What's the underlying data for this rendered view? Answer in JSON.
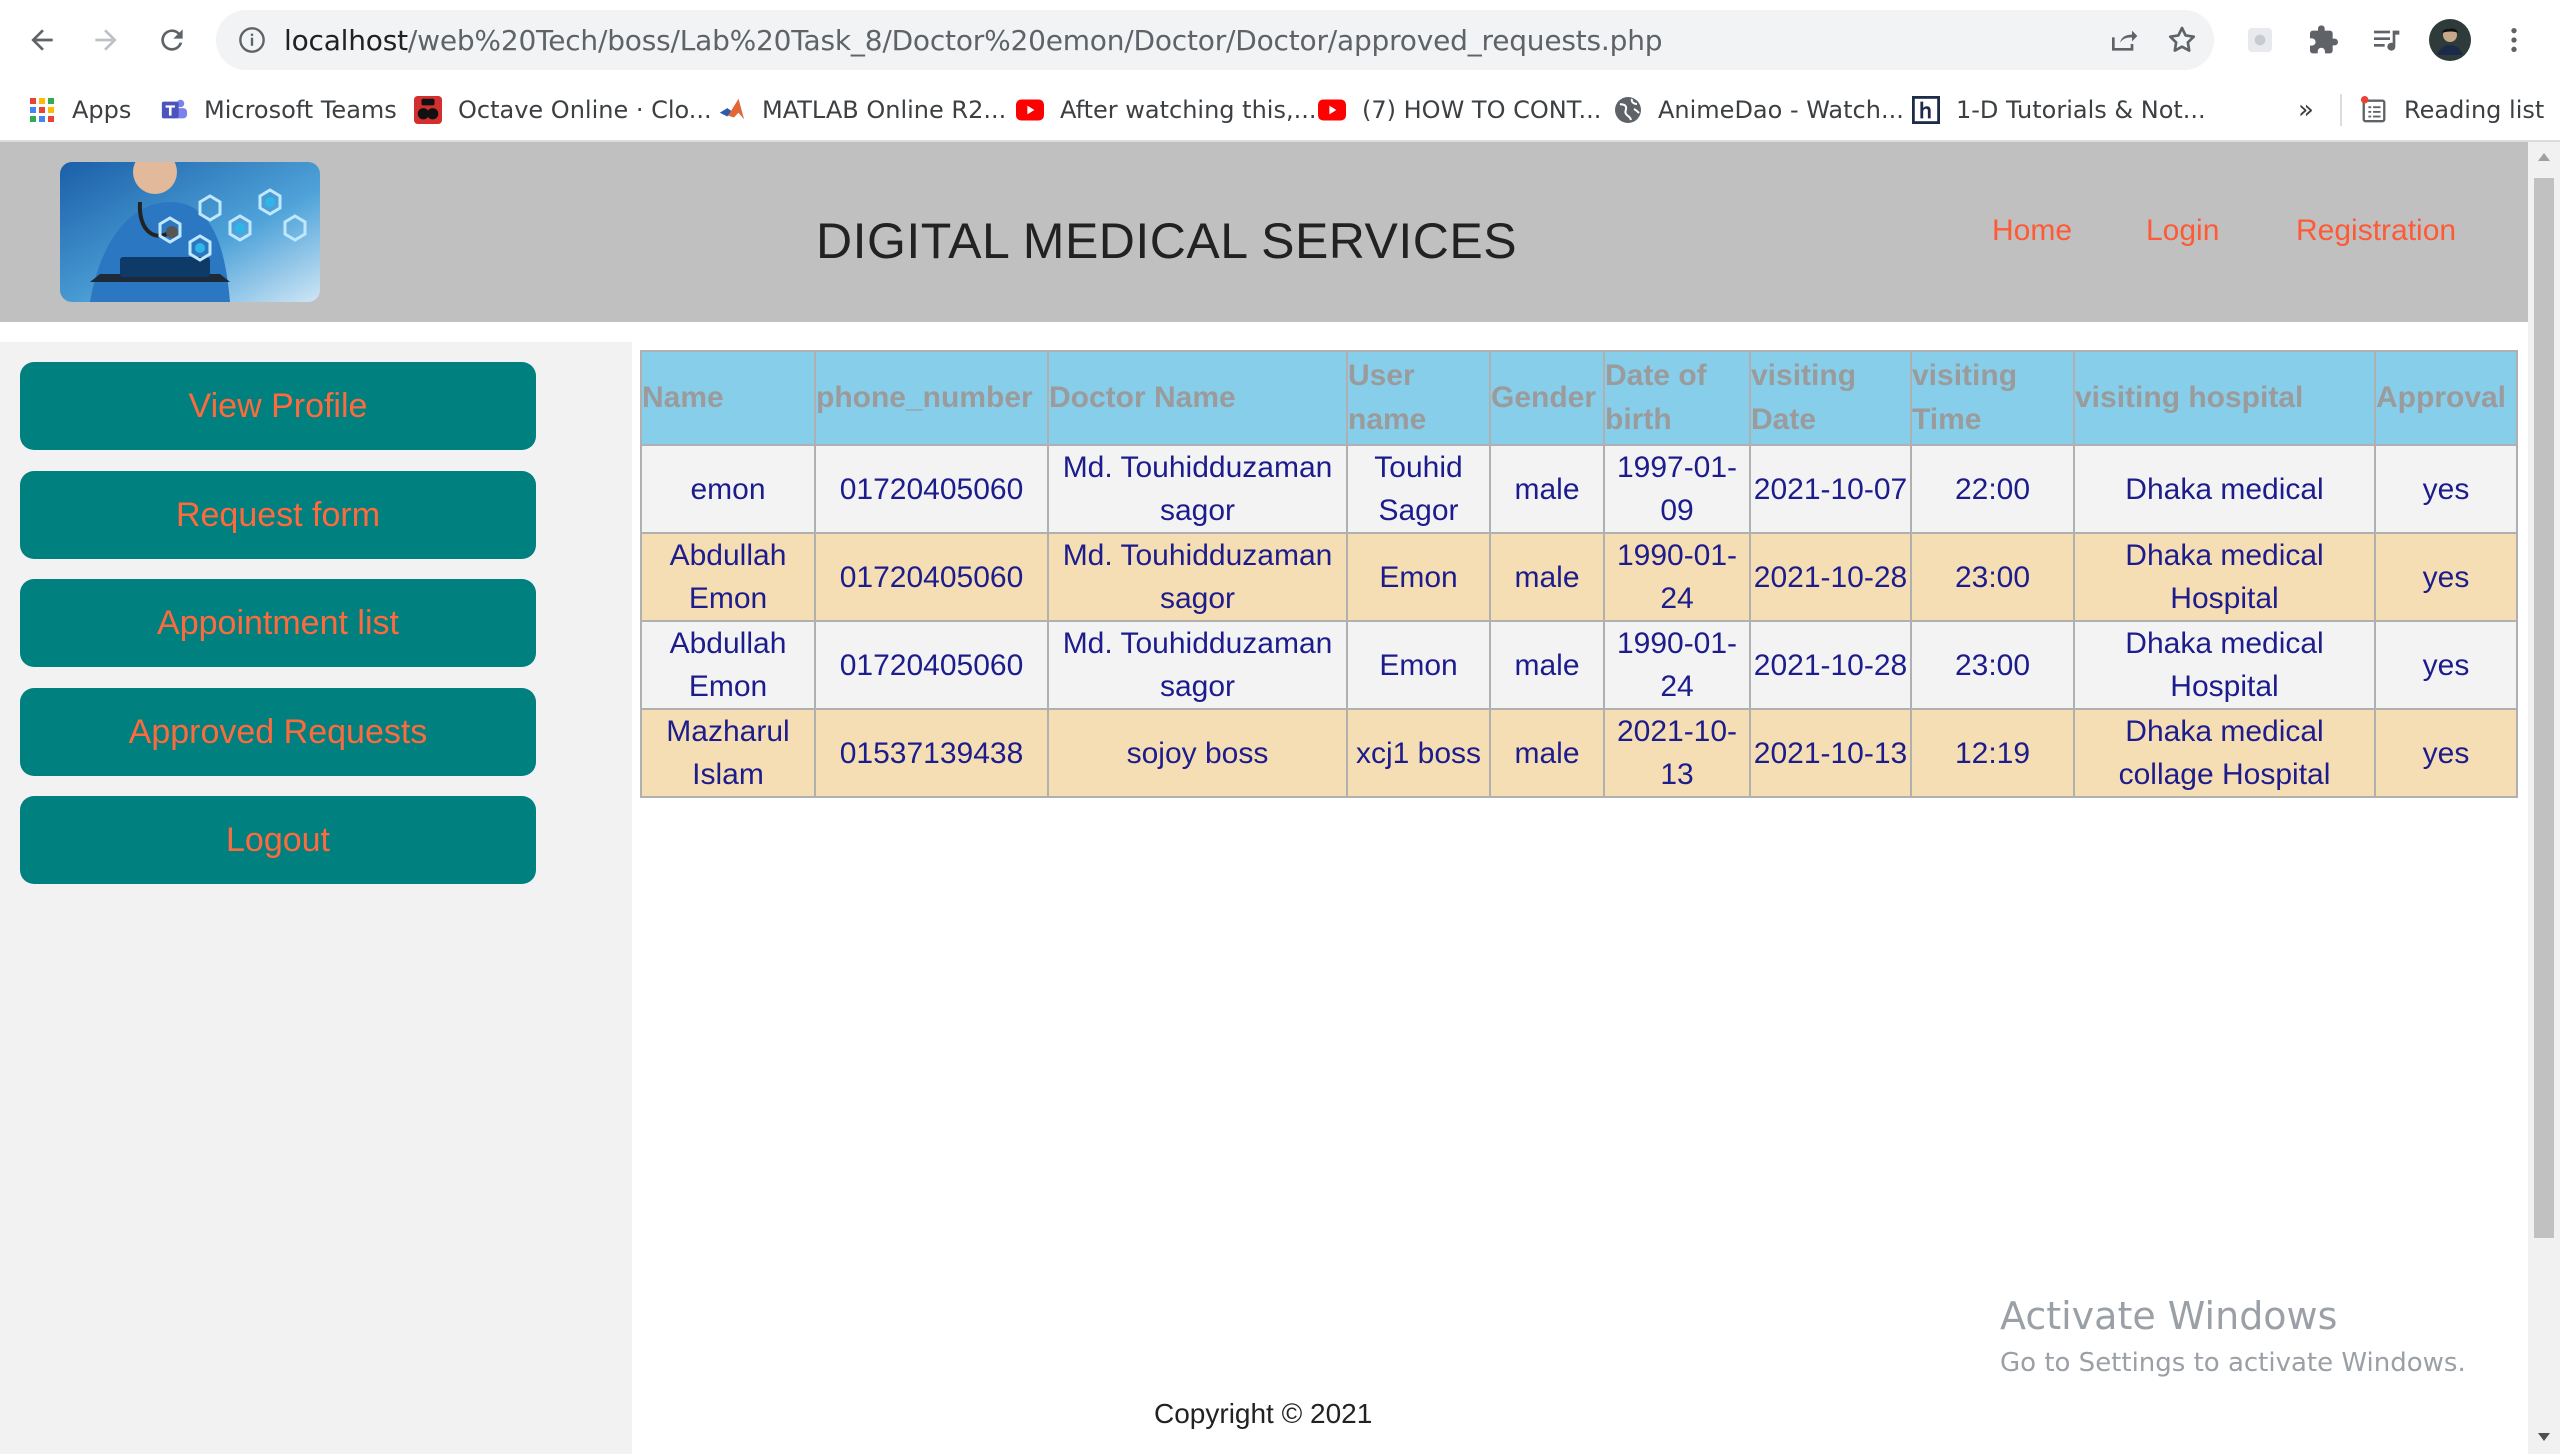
{
  "browser": {
    "url_host": "localhost",
    "url_path": "/web%20Tech/boss/Lab%20Task_8/Doctor%20emon/Doctor/Doctor/approved_requests.php",
    "bookmarks": [
      {
        "label": "Apps",
        "icon": "apps-grid-icon"
      },
      {
        "label": "Microsoft Teams",
        "icon": "teams-icon"
      },
      {
        "label": "Octave Online · Clo...",
        "icon": "octave-icon"
      },
      {
        "label": "MATLAB Online R2...",
        "icon": "matlab-icon"
      },
      {
        "label": "After watching this,...",
        "icon": "youtube-icon"
      },
      {
        "label": "(7) HOW TO CONT...",
        "icon": "youtube-icon"
      },
      {
        "label": "AnimeDao - Watch...",
        "icon": "globe-icon"
      },
      {
        "label": "1-D Tutorials & Not...",
        "icon": "h-icon"
      }
    ],
    "overflow_label": "»",
    "reading_list": "Reading list"
  },
  "header": {
    "title": "DIGITAL MEDICAL SERVICES",
    "links": [
      "Home",
      "Login",
      "Registration"
    ]
  },
  "sidebar": {
    "items": [
      "View Profile",
      "Request form",
      "Appointment list",
      "Approved Requests",
      "Logout"
    ]
  },
  "table": {
    "columns": [
      "Name",
      "phone_number",
      "Doctor Name",
      "User name",
      "Gender",
      "Date of birth",
      "visiting Date",
      "visiting Time",
      "visiting hospital",
      "Approval"
    ],
    "rows": [
      [
        "emon",
        "01720405060",
        "Md. Touhidduzaman sagor",
        "Touhid Sagor",
        "male",
        "1997-01-09",
        "2021-10-07",
        "22:00",
        "Dhaka medical",
        "yes"
      ],
      [
        "Abdullah Emon",
        "01720405060",
        "Md. Touhidduzaman sagor",
        "Emon",
        "male",
        "1990-01-24",
        "2021-10-28",
        "23:00",
        "Dhaka medical Hospital",
        "yes"
      ],
      [
        "Abdullah Emon",
        "01720405060",
        "Md. Touhidduzaman sagor",
        "Emon",
        "male",
        "1990-01-24",
        "2021-10-28",
        "23:00",
        "Dhaka medical Hospital",
        "yes"
      ],
      [
        "Mazharul Islam",
        "01537139438",
        "sojoy boss",
        "xcj1 boss",
        "male",
        "2021-10-13",
        "2021-10-13",
        "12:19",
        "Dhaka medical collage Hospital",
        "yes"
      ]
    ]
  },
  "footer": {
    "copyright": "Copyright © 2021"
  },
  "watermark": {
    "title": "Activate Windows",
    "subtitle": "Go to Settings to activate Windows."
  },
  "colors": {
    "header_bg": "#c0c0c0",
    "sidebar_button": "#00807f",
    "link_orange": "#ff5a36",
    "table_header": "#87ceeb",
    "row_alt": "#f5deb3"
  }
}
